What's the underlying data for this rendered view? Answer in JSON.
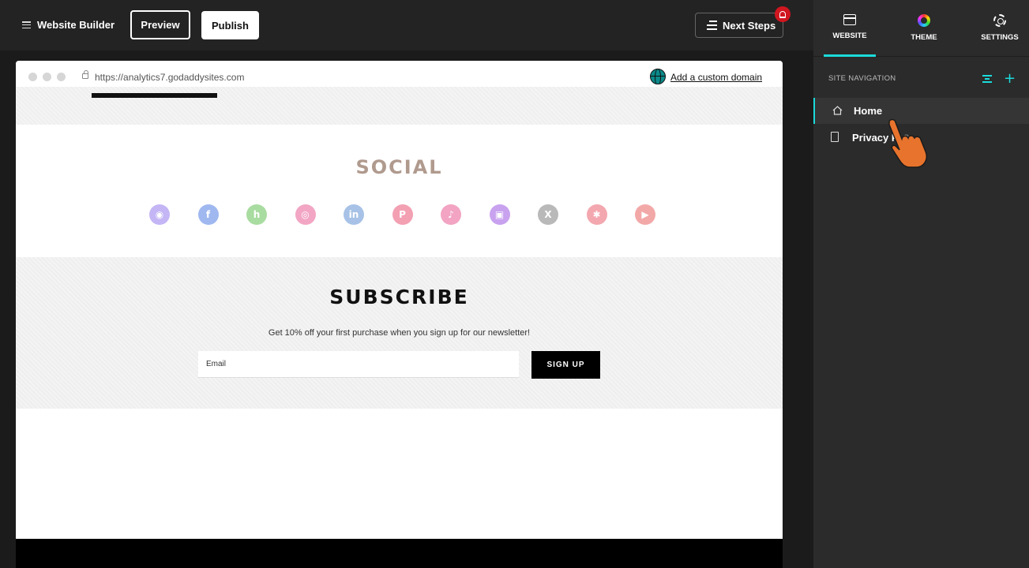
{
  "topbar": {
    "app_title": "Website Builder",
    "preview_label": "Preview",
    "publish_label": "Publish",
    "next_steps_label": "Next Steps"
  },
  "browser": {
    "url": "https://analytics7.godaddysites.com",
    "custom_domain_link": "Add a custom domain"
  },
  "social": {
    "title": "SOCIAL",
    "icons": [
      {
        "name": "discord-icon",
        "glyph": "◉",
        "color": "#c4b5f5"
      },
      {
        "name": "facebook-icon",
        "glyph": "f",
        "color": "#9fb8ef"
      },
      {
        "name": "houzz-icon",
        "glyph": "h",
        "color": "#a9dca0"
      },
      {
        "name": "instagram-icon",
        "glyph": "◎",
        "color": "#f2a6c4"
      },
      {
        "name": "linkedin-icon",
        "glyph": "in",
        "color": "#a7c2e6"
      },
      {
        "name": "pinterest-icon",
        "glyph": "P",
        "color": "#f3a0b3"
      },
      {
        "name": "tiktok-icon",
        "glyph": "♪",
        "color": "#f2a4c2"
      },
      {
        "name": "twitch-icon",
        "glyph": "▣",
        "color": "#c8a2ef"
      },
      {
        "name": "x-icon",
        "glyph": "X",
        "color": "#b9b9b9"
      },
      {
        "name": "yelp-icon",
        "glyph": "✱",
        "color": "#f3a7ae"
      },
      {
        "name": "youtube-icon",
        "glyph": "▶",
        "color": "#f3a8a8"
      }
    ]
  },
  "subscribe": {
    "title": "SUBSCRIBE",
    "text": "Get 10% off your first purchase when you sign up for our newsletter!",
    "email_placeholder": "Email",
    "signup_label": "SIGN UP"
  },
  "panel": {
    "tabs": [
      {
        "label": "WEBSITE",
        "active": true
      },
      {
        "label": "THEME",
        "active": false
      },
      {
        "label": "SETTINGS",
        "active": false
      }
    ],
    "section_title": "SITE NAVIGATION",
    "nav_items": [
      {
        "label": "Home",
        "active": true
      },
      {
        "label": "Privacy P",
        "active": false
      }
    ]
  },
  "colors": {
    "accent": "#1bdbdb",
    "notification": "#d0161f",
    "cursor": "#e8732c"
  }
}
